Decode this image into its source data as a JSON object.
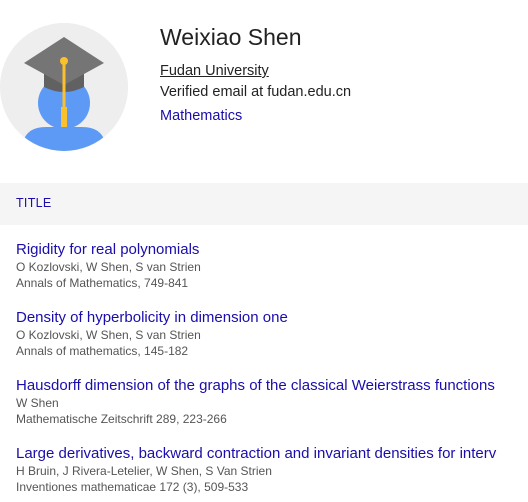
{
  "profile": {
    "name": "Weixiao Shen",
    "affiliation": "Fudan University",
    "verified": "Verified email at fudan.edu.cn",
    "interest": "Mathematics"
  },
  "table": {
    "title_header": "TITLE"
  },
  "papers": [
    {
      "title": "Rigidity for real polynomials",
      "authors": "O Kozlovski, W Shen, S van Strien",
      "venue": "Annals of Mathematics, 749-841"
    },
    {
      "title": "Density of hyperbolicity in dimension one",
      "authors": "O Kozlovski, W Shen, S van Strien",
      "venue": "Annals of mathematics, 145-182"
    },
    {
      "title": "Hausdorff dimension of the graphs of the classical Weierstrass functions",
      "authors": "W Shen",
      "venue": "Mathematische Zeitschrift 289, 223-266"
    },
    {
      "title": "Large derivatives, backward contraction and invariant densities for interv",
      "authors": "H Bruin, J Rivera-Letelier, W Shen, S Van Strien",
      "venue": "Inventiones mathematicae 172 (3), 509-533"
    }
  ],
  "colors": {
    "link": "#1a0dab",
    "header_bg": "#f5f5f5",
    "avatar_bg": "#eeeeee",
    "avatar_person": "#4285f4",
    "cap": "#757575",
    "tassel": "#fbc02d"
  }
}
